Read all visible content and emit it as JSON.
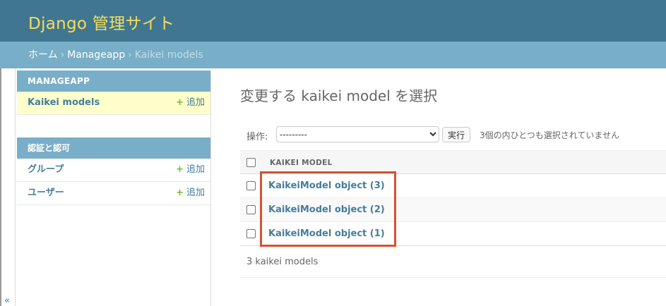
{
  "header": {
    "site_name": "Django 管理サイト"
  },
  "breadcrumbs": {
    "home": "ホーム",
    "separator": "›",
    "app": "Manageapp",
    "current": "Kaikei models"
  },
  "sidebar": {
    "collapse_icon": "«",
    "modules": [
      {
        "caption": "Manageapp",
        "items": [
          {
            "name": "Kaikei models",
            "add_label": "追加",
            "add_icon": "+"
          }
        ]
      },
      {
        "caption": "認証と認可",
        "items": [
          {
            "name": "グループ",
            "add_label": "追加",
            "add_icon": "+"
          },
          {
            "name": "ユーザー",
            "add_label": "追加",
            "add_icon": "+"
          }
        ]
      }
    ]
  },
  "content": {
    "title": "変更する kaikei model を選択",
    "actions": {
      "label": "操作:",
      "selected_option": "---------",
      "run_label": "実行",
      "counter": "3個の内ひとつも選択されていません"
    },
    "table": {
      "column_header": "Kaikei model",
      "rows": [
        {
          "label": "KaikeiModel object (3)"
        },
        {
          "label": "KaikeiModel object (2)"
        },
        {
          "label": "KaikeiModel object (1)"
        }
      ]
    },
    "paginator": "3 kaikei models"
  },
  "colors": {
    "header_bg": "#417690",
    "branding": "#f5dd5d",
    "breadcrumbs_bg": "#79aec8",
    "link": "#447e9b",
    "add_plus": "#70bf2b",
    "highlight_border": "#d9502e",
    "current_row": "#ffffcc"
  }
}
